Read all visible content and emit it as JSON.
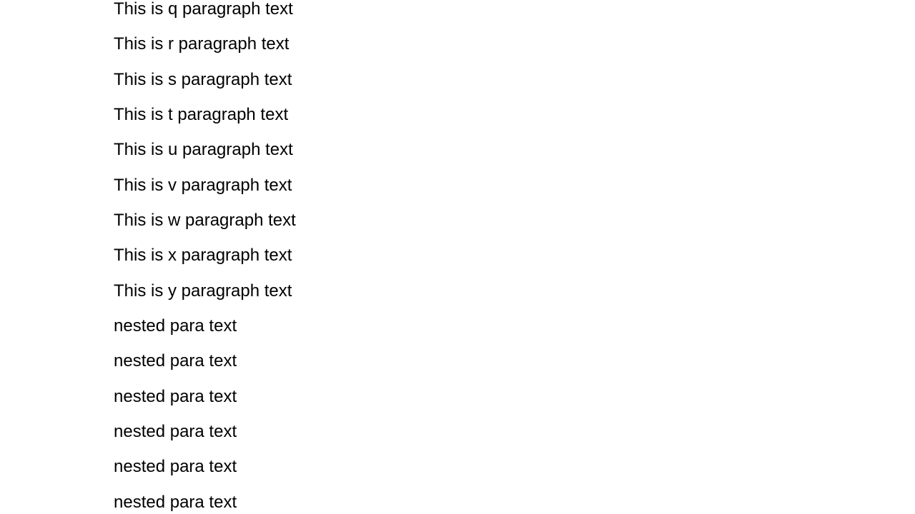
{
  "paragraphs": [
    "This is q paragraph text",
    "This is r paragraph text",
    "This is s paragraph text",
    "This is t paragraph text",
    "This is u paragraph text",
    "This is v paragraph text",
    "This is w paragraph text",
    "This is x paragraph text",
    "This is y paragraph text",
    "nested para text",
    "nested para text",
    "nested para text",
    "nested para text",
    "nested para text",
    "nested para text"
  ]
}
